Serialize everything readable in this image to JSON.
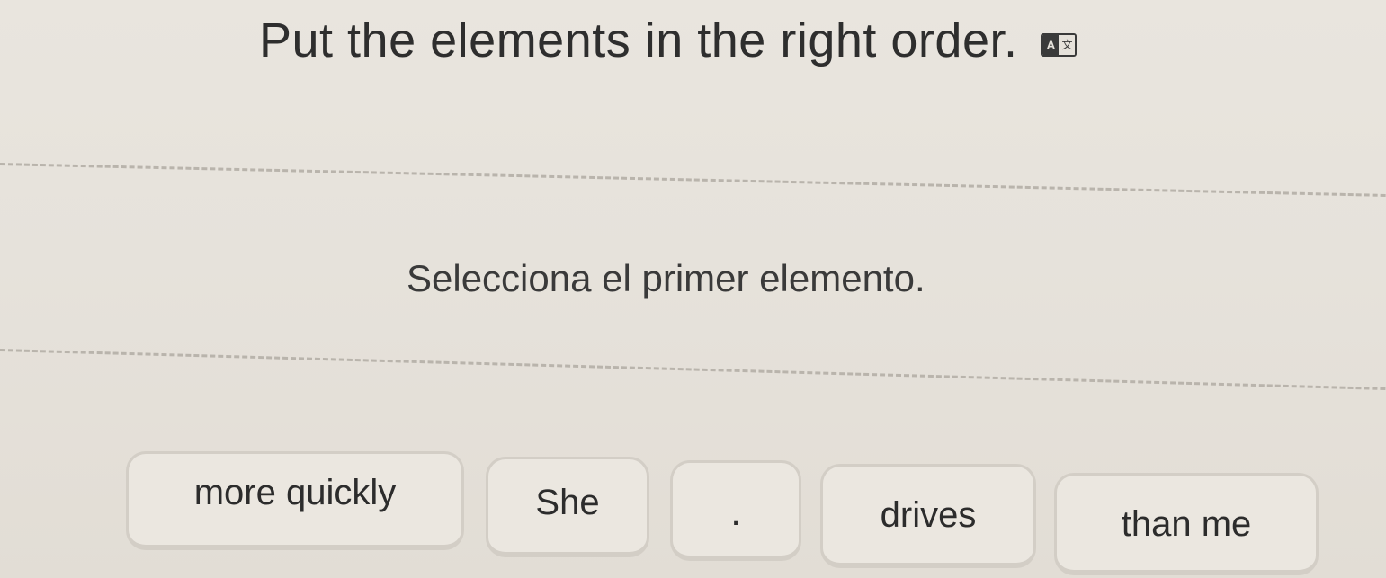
{
  "instruction": {
    "text": "Put the elements in the right order.",
    "translate_icon": "translate-icon"
  },
  "prompt": {
    "text": "Selecciona el primer elemento."
  },
  "tokens": [
    {
      "label": "more quickly"
    },
    {
      "label": "She"
    },
    {
      "label": "."
    },
    {
      "label": "drives"
    },
    {
      "label": "than me"
    }
  ]
}
